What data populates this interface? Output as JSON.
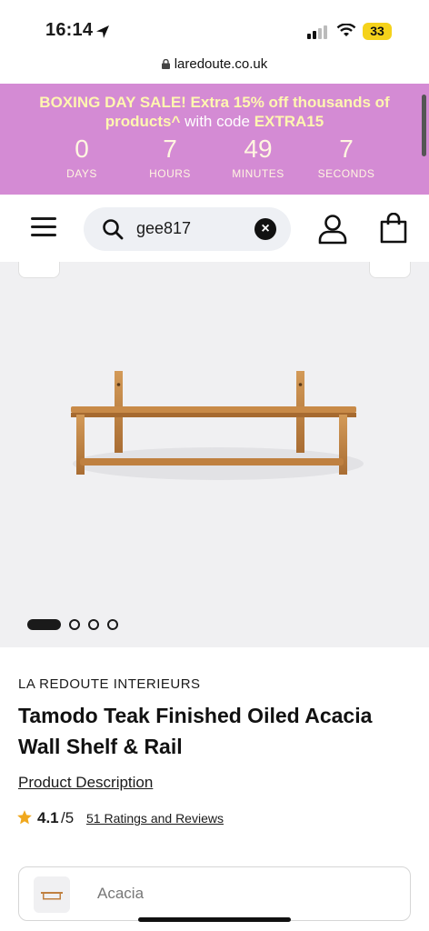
{
  "status_bar": {
    "time": "16:14",
    "battery": "33",
    "icons": [
      "location-arrow-icon",
      "signal-icon",
      "wifi-icon",
      "battery-icon"
    ]
  },
  "browser": {
    "url": "laredoute.co.uk"
  },
  "promo": {
    "line1": "BOXING DAY SALE! Extra 15% off thousands of",
    "line2_bold": "products^",
    "line2_light": " with code ",
    "line2_code": "EXTRA15",
    "background": "#d48bd4",
    "countdown": [
      {
        "value": "0",
        "label": "DAYS"
      },
      {
        "value": "7",
        "label": "HOURS"
      },
      {
        "value": "49",
        "label": "MINUTES"
      },
      {
        "value": "7",
        "label": "SECONDS"
      }
    ]
  },
  "header": {
    "search_value": "gee817",
    "icons": [
      "menu-icon",
      "search-icon",
      "clear-icon",
      "account-icon",
      "bag-icon"
    ]
  },
  "gallery": {
    "image": "wall-shelf-rail-photo",
    "slides_total": 4,
    "slide_active": 1
  },
  "product": {
    "brand": "LA REDOUTE INTERIEURS",
    "title": "Tamodo Teak Finished Oiled Acacia Wall Shelf & Rail",
    "description_link": "Product Description",
    "rating": "4.1",
    "rating_max": "/5",
    "reviews_link": "51 Ratings and Reviews",
    "star_color": "#f0a81e"
  },
  "variant": {
    "label": "Acacia"
  }
}
